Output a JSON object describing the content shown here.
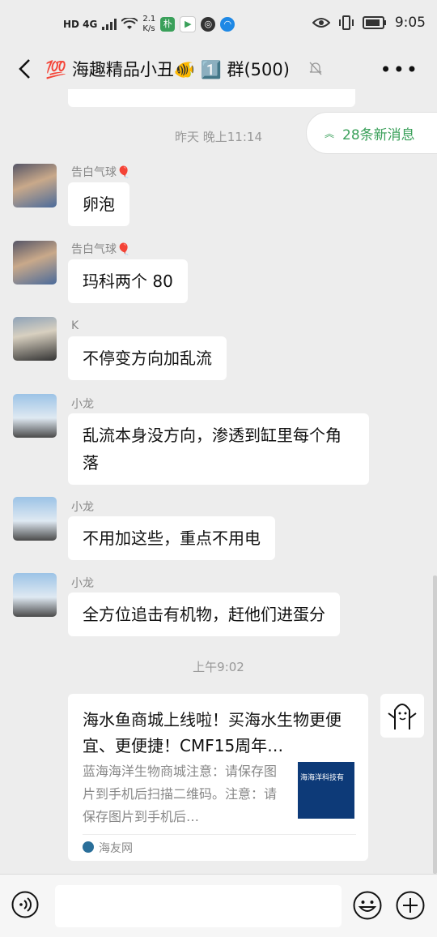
{
  "status_bar": {
    "network": "HD 4G",
    "speed_value": "2.1",
    "speed_unit": "K/s",
    "time": "9:05"
  },
  "header": {
    "title": "💯 海趣精品小丑🐠 1️⃣ 群(500)"
  },
  "chat": {
    "new_messages_label": "28条新消息",
    "timestamp_1": "昨天 晚上11:14",
    "timestamp_2": "上午9:02",
    "messages": [
      {
        "sender": "告白气球🎈",
        "text": "卵泡"
      },
      {
        "sender": "告白气球🎈",
        "text": "玛科两个 80"
      },
      {
        "sender": "K",
        "text": "不停变方向加乱流"
      },
      {
        "sender": "小龙",
        "text": "乱流本身没方向，渗透到缸里每个角落"
      },
      {
        "sender": "小龙",
        "text": "不用加这些，重点不用电"
      },
      {
        "sender": "小龙",
        "text": "全方位追击有机物，赶他们进蛋分"
      }
    ],
    "link_card": {
      "title": "海水鱼商城上线啦！买海水生物更便宜、更便捷！CMF15周年…",
      "description": "蓝海海洋生物商城注意：请保存图片到手机后扫描二维码。注意：请保存图片到手机后…",
      "thumbnail_text": "海海洋科技有",
      "source": "海友网"
    }
  },
  "colors": {
    "accent_green": "#3aa05a",
    "background": "#ededed",
    "bubble": "#ffffff"
  }
}
